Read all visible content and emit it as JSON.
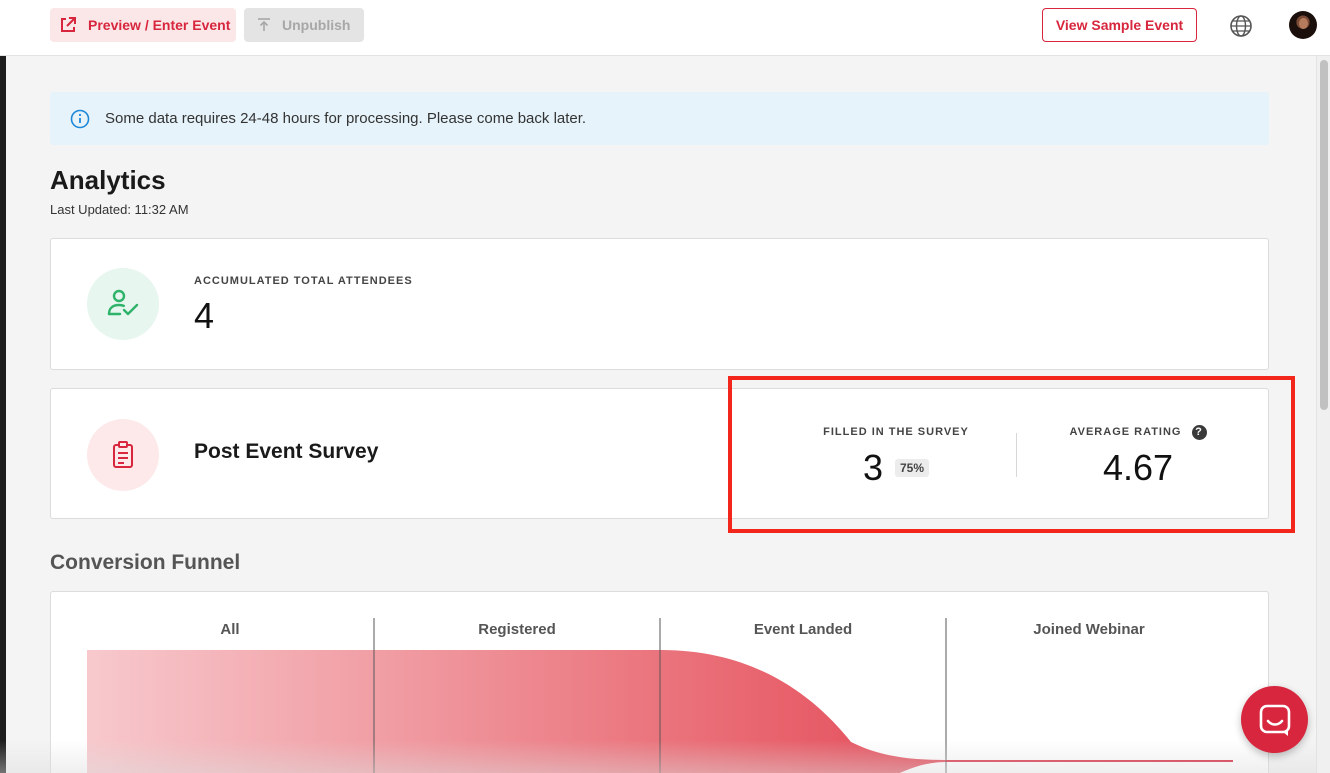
{
  "topbar": {
    "preview_label": "Preview / Enter Event",
    "unpublish_label": "Unpublish",
    "sample_label": "View Sample Event",
    "icons": {
      "preview": "external-link-icon",
      "unpublish": "upload-icon",
      "language": "globe-icon"
    }
  },
  "banner": {
    "text": "Some data requires 24-48 hours for processing. Please come back later.",
    "icon": "info-icon"
  },
  "analytics": {
    "title": "Analytics",
    "last_updated": "Last Updated: 11:32 AM"
  },
  "attendees": {
    "label": "ACCUMULATED TOTAL ATTENDEES",
    "value": "4",
    "icon": "user-check-icon"
  },
  "survey": {
    "title": "Post Event Survey",
    "icon": "clipboard-icon",
    "filled_label": "FILLED IN THE SURVEY",
    "filled_value": "3",
    "filled_percent": "75%",
    "rating_label": "AVERAGE RATING",
    "rating_value": "4.67",
    "help_symbol": "?"
  },
  "funnel": {
    "title": "Conversion Funnel",
    "stages": [
      "All",
      "Registered",
      "Event Landed",
      "Joined Webinar"
    ]
  },
  "colors": {
    "brand": "#d7263d",
    "highlight": "#f2261a",
    "success": "#2fb36b"
  }
}
